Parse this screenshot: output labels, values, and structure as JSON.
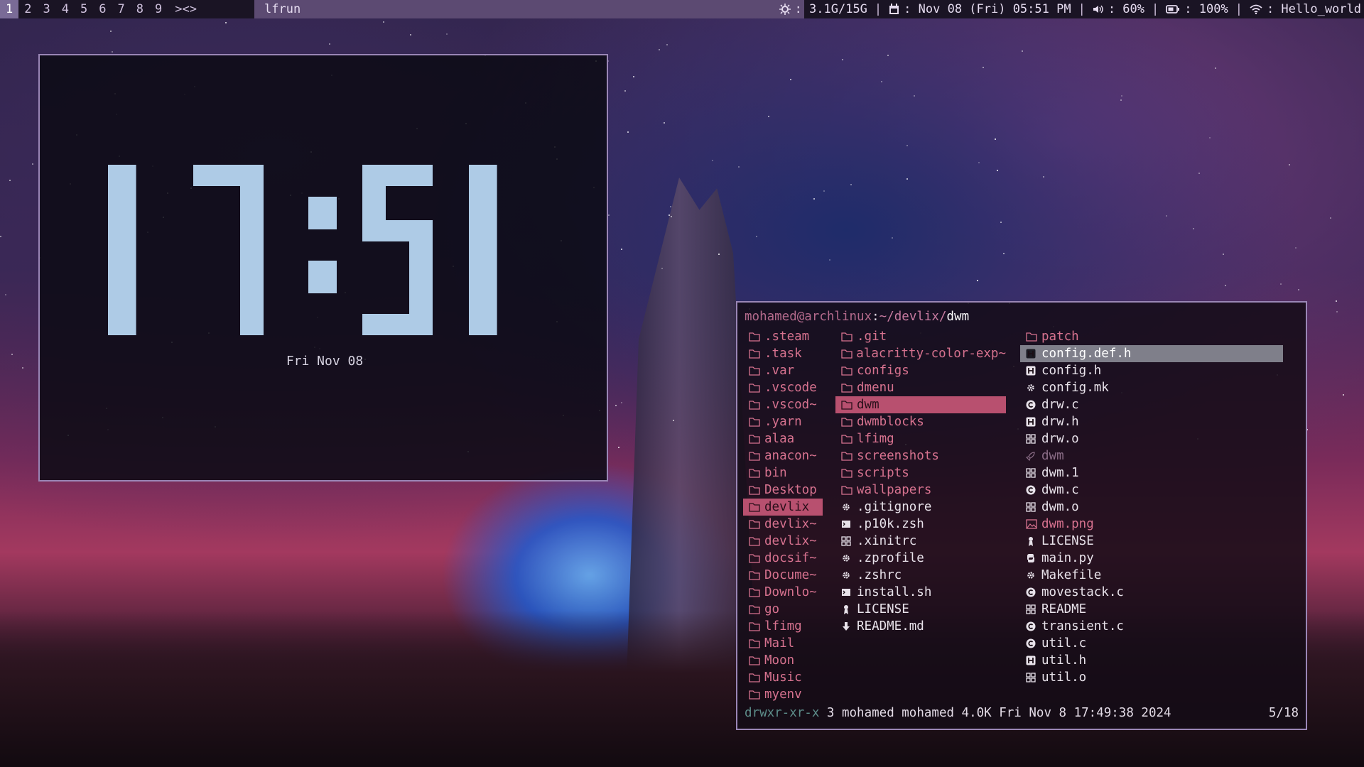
{
  "topbar": {
    "tags": [
      "1",
      "2",
      "3",
      "4",
      "5",
      "6",
      "7",
      "8",
      "9"
    ],
    "active_tag": "1",
    "layout": "><>",
    "window_title": "lfrun",
    "status": [
      {
        "icon": "cpu-icon",
        "text": ": 3.1G/15G"
      },
      {
        "icon": "calendar-icon",
        "text": ": Nov 08 (Fri) 05:51 PM"
      },
      {
        "icon": "volume-icon",
        "text": ": 60%"
      },
      {
        "icon": "battery-icon",
        "text": ": 100%"
      },
      {
        "icon": "wifi-icon",
        "text": ": Hello_world"
      }
    ]
  },
  "clock": {
    "time": "17:51",
    "date": "Fri Nov 08",
    "digit_color": "#aecbe6"
  },
  "lf": {
    "path_user": "mohamed@archlinux",
    "path_sep": ":",
    "path_dir": "~/devlix/",
    "path_current": "dwm",
    "parent_column": [
      {
        "name": ".steam",
        "type": "dir"
      },
      {
        "name": ".task",
        "type": "dir"
      },
      {
        "name": ".var",
        "type": "dir"
      },
      {
        "name": ".vscode",
        "type": "dir"
      },
      {
        "name": ".vscod~",
        "type": "dir"
      },
      {
        "name": ".yarn",
        "type": "dir"
      },
      {
        "name": "alaa",
        "type": "dir"
      },
      {
        "name": "anacon~",
        "type": "dir"
      },
      {
        "name": "bin",
        "type": "dir"
      },
      {
        "name": "Desktop",
        "type": "dir"
      },
      {
        "name": "devlix",
        "type": "dir",
        "selected": true
      },
      {
        "name": "devlix~",
        "type": "dir"
      },
      {
        "name": "devlix~",
        "type": "dir"
      },
      {
        "name": "docsif~",
        "type": "dir"
      },
      {
        "name": "Docume~",
        "type": "dir"
      },
      {
        "name": "Downlo~",
        "type": "dir"
      },
      {
        "name": "go",
        "type": "dir"
      },
      {
        "name": "lfimg",
        "type": "dir"
      },
      {
        "name": "Mail",
        "type": "dir"
      },
      {
        "name": "Moon",
        "type": "dir"
      },
      {
        "name": "Music",
        "type": "dir"
      },
      {
        "name": "myenv",
        "type": "dir"
      }
    ],
    "current_column": [
      {
        "name": ".git",
        "type": "dir"
      },
      {
        "name": "alacritty-color-exp~",
        "type": "dir"
      },
      {
        "name": "configs",
        "type": "dir"
      },
      {
        "name": "dmenu",
        "type": "dir"
      },
      {
        "name": "dwm",
        "type": "dir",
        "selected": true
      },
      {
        "name": "dwmblocks",
        "type": "dir"
      },
      {
        "name": "lfimg",
        "type": "dir"
      },
      {
        "name": "screenshots",
        "type": "dir"
      },
      {
        "name": "scripts",
        "type": "dir"
      },
      {
        "name": "wallpapers",
        "type": "dir"
      },
      {
        "name": ".gitignore",
        "type": "gear"
      },
      {
        "name": ".p10k.zsh",
        "type": "term"
      },
      {
        "name": ".xinitrc",
        "type": "obj"
      },
      {
        "name": ".zprofile",
        "type": "gear"
      },
      {
        "name": ".zshrc",
        "type": "gear"
      },
      {
        "name": "install.sh",
        "type": "term"
      },
      {
        "name": "LICENSE",
        "type": "license"
      },
      {
        "name": "README.md",
        "type": "down"
      }
    ],
    "preview_column": [
      {
        "name": "patch",
        "type": "dir"
      },
      {
        "name": "config.def.h",
        "type": "h",
        "selected": true
      },
      {
        "name": "config.h",
        "type": "h"
      },
      {
        "name": "config.mk",
        "type": "gear"
      },
      {
        "name": "drw.c",
        "type": "c"
      },
      {
        "name": "drw.h",
        "type": "h"
      },
      {
        "name": "drw.o",
        "type": "obj"
      },
      {
        "name": "dwm",
        "type": "exe",
        "dim": true
      },
      {
        "name": "dwm.1",
        "type": "obj"
      },
      {
        "name": "dwm.c",
        "type": "c"
      },
      {
        "name": "dwm.o",
        "type": "obj"
      },
      {
        "name": "dwm.png",
        "type": "img"
      },
      {
        "name": "LICENSE",
        "type": "license"
      },
      {
        "name": "main.py",
        "type": "py"
      },
      {
        "name": "Makefile",
        "type": "gear"
      },
      {
        "name": "movestack.c",
        "type": "c"
      },
      {
        "name": "README",
        "type": "obj"
      },
      {
        "name": "transient.c",
        "type": "c"
      },
      {
        "name": "util.c",
        "type": "c"
      },
      {
        "name": "util.h",
        "type": "h"
      },
      {
        "name": "util.o",
        "type": "obj"
      }
    ],
    "status_perm": "drwxr-xr-x",
    "status_info": "3 mohamed mohamed 4.0K Fri Nov  8 17:49:38 2024",
    "status_count": "5/18"
  }
}
